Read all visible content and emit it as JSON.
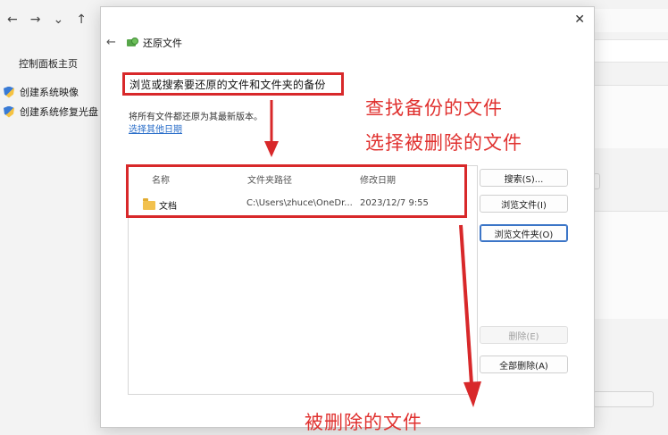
{
  "background_window": {
    "nav_glyphs": [
      "←",
      "→",
      "⌄",
      "↑"
    ],
    "sidebar_home": "控制面板主页",
    "sidebar_links": [
      {
        "label": "创建系统映像",
        "icon": "shield-icon"
      },
      {
        "label": "创建系统修复光盘",
        "icon": "shield-icon"
      }
    ]
  },
  "dialog": {
    "close_glyph": "✕",
    "back_glyph": "←",
    "title": "还原文件",
    "heading": "浏览或搜索要还原的文件和文件夹的备份",
    "description": "将所有文件都还原为其最新版本。",
    "date_link": "选择其他日期",
    "columns": [
      "名称",
      "文件夹路径",
      "修改日期"
    ],
    "rows": [
      {
        "name": "文档",
        "path": "C:\\Users\\zhuce\\OneDr...",
        "date": "2023/12/7 9:55",
        "icon": "folder-icon"
      }
    ],
    "buttons": {
      "search": "搜索(S)...",
      "browse_files": "浏览文件(I)",
      "browse_folders": "浏览文件夹(O)",
      "delete": "删除(E)",
      "delete_all": "全部删除(A)"
    }
  },
  "annotations": {
    "line1": "查找备份的文件",
    "line2": "选择被删除的文件",
    "line3": "被删除的文件",
    "color": "#e0312f"
  }
}
